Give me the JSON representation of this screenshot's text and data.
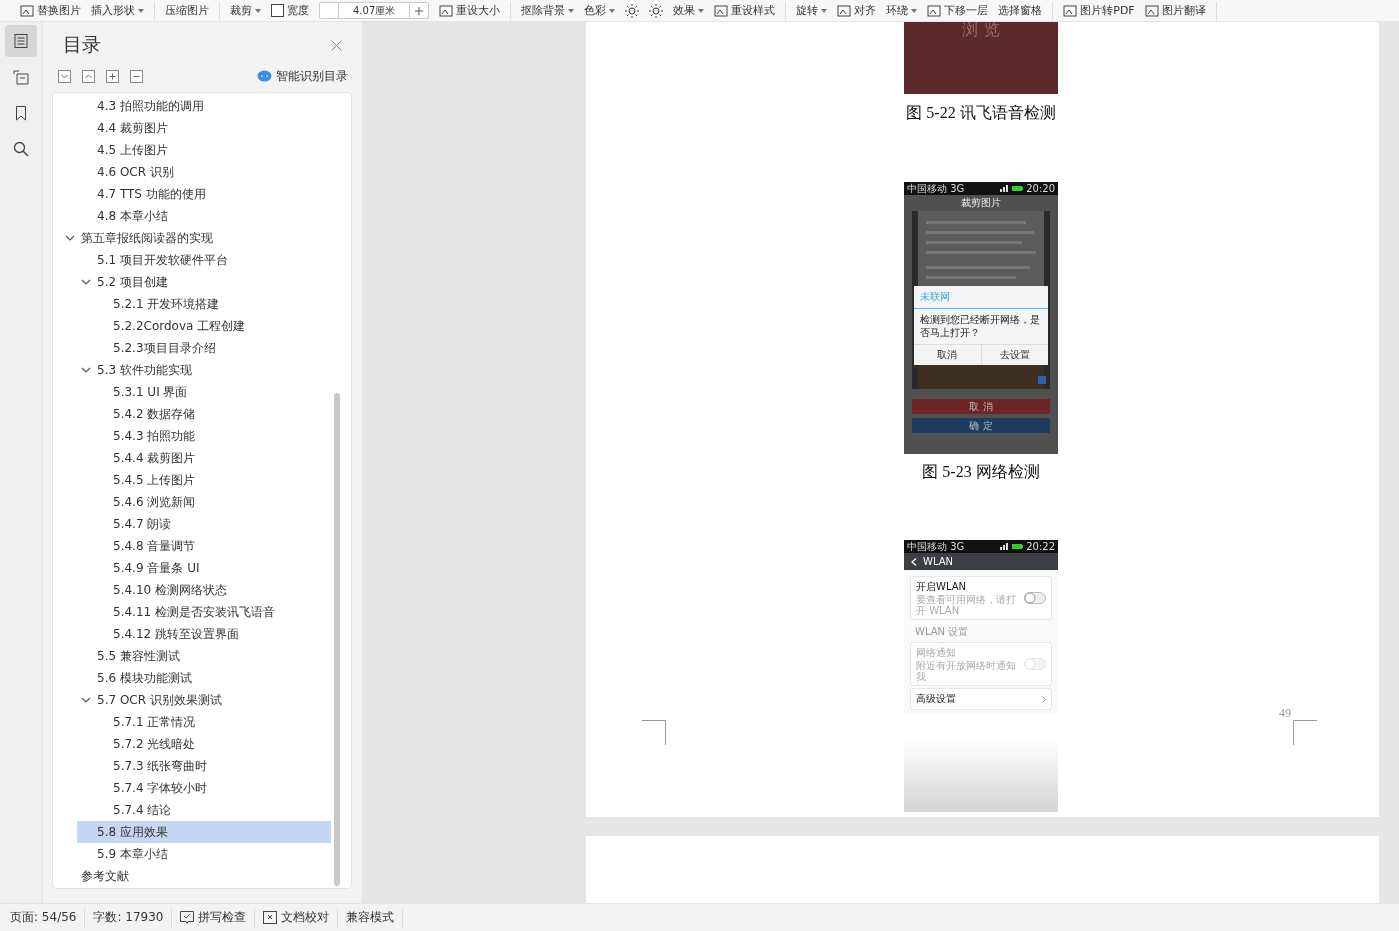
{
  "toolbar": [
    [
      {
        "label": "替换图片",
        "kind": "icon"
      },
      {
        "label": "插入形状",
        "kind": "dropdown"
      }
    ],
    [
      {
        "label": "压缩图片",
        "kind": "plain"
      }
    ],
    [
      {
        "label": "裁剪",
        "kind": "dropdown"
      },
      {
        "label": "宽度",
        "kind": "check",
        "checked": false
      },
      {
        "label": "4.07厘米",
        "kind": "field"
      },
      {
        "label": "重设大小",
        "kind": "icon"
      }
    ],
    [
      {
        "label": "抠除背景",
        "kind": "dropdown"
      },
      {
        "label": "色彩",
        "kind": "dropdown"
      },
      {
        "kind": "sun"
      },
      {
        "kind": "sun"
      },
      {
        "label": "效果",
        "kind": "dropdown"
      },
      {
        "label": "重设样式",
        "kind": "icon"
      }
    ],
    [
      {
        "label": "旋转",
        "kind": "dropdown"
      },
      {
        "label": "对齐",
        "kind": "icon"
      },
      {
        "label": "环绕",
        "kind": "dropdown"
      },
      {
        "label": "下移一层",
        "kind": "icon"
      },
      {
        "label": "选择窗格",
        "kind": "plain"
      }
    ],
    [
      {
        "label": "图片转PDF",
        "kind": "icon"
      },
      {
        "label": "图片翻译",
        "kind": "icon"
      }
    ]
  ],
  "nav": [
    {
      "kind": "toc",
      "selected": true
    },
    {
      "kind": "outline",
      "selected": false
    },
    {
      "kind": "bookmark",
      "selected": false
    },
    {
      "kind": "search",
      "selected": false
    }
  ],
  "toc": {
    "title": "目录",
    "smart_label": "智能识别目录",
    "continued": [
      {
        "label": "4.3 拍照功能的调用",
        "selected": false
      },
      {
        "label": "4.4 裁剪图片",
        "selected": false
      },
      {
        "label": "4.5  上传图片",
        "selected": false
      },
      {
        "label": "4.6 OCR 识别",
        "selected": false
      },
      {
        "label": "4.7 TTS 功能的使用",
        "selected": false
      },
      {
        "label": "4.8  本章小结",
        "selected": false
      }
    ],
    "items": [
      {
        "label": "第五章报纸阅读器的实现",
        "selected": false,
        "expanded": true,
        "children": [
          {
            "label": "5.1 项目开发软硬件平台",
            "selected": false
          },
          {
            "label": "5.2 项目创建",
            "selected": false,
            "expanded": true,
            "children": [
              {
                "label": "5.2.1  开发环境搭建",
                "selected": false
              },
              {
                "label": "5.2.2Cordova 工程创建",
                "selected": false
              },
              {
                "label": "5.2.3项目目录介绍",
                "selected": false
              }
            ]
          },
          {
            "label": "5.3 软件功能实现",
            "selected": false,
            "expanded": true,
            "children": [
              {
                "label": "5.3.1 UI 界面",
                "selected": false
              },
              {
                "label": "5.4.2 数据存储",
                "selected": false
              },
              {
                "label": "5.4.3  拍照功能",
                "selected": false
              },
              {
                "label": "5.4.4  裁剪图片",
                "selected": false
              },
              {
                "label": "5.4.5  上传图片",
                "selected": false
              },
              {
                "label": "5.4.6  浏览新闻",
                "selected": false
              },
              {
                "label": "5.4.7  朗读",
                "selected": false
              },
              {
                "label": "5.4.8  音量调节",
                "selected": false
              },
              {
                "label": "5.4.9  音量条 UI",
                "selected": false
              },
              {
                "label": "5.4.10 检测网络状态",
                "selected": false
              },
              {
                "label": "5.4.11 检测是否安装讯飞语音",
                "selected": false
              },
              {
                "label": "5.4.12 跳转至设置界面",
                "selected": false
              }
            ]
          },
          {
            "label": "5.5  兼容性测试",
            "selected": false
          },
          {
            "label": "5.6  模块功能测试",
            "selected": false
          },
          {
            "label": "5.7  OCR 识别效果测试",
            "selected": false,
            "expanded": true,
            "children": [
              {
                "label": "5.7.1 正常情况",
                "selected": false
              },
              {
                "label": "5.7.2 光线暗处",
                "selected": false
              },
              {
                "label": "5.7.3 纸张弯曲时",
                "selected": false
              },
              {
                "label": "5.7.4 字体较小时",
                "selected": false
              },
              {
                "label": "5.7.4 结论",
                "selected": false
              }
            ]
          },
          {
            "label": "5.8  应用效果",
            "selected": true
          },
          {
            "label": "5.9  本章小结",
            "selected": false
          }
        ]
      },
      {
        "label": "参考文献",
        "selected": false
      }
    ]
  },
  "document": {
    "top_image_label": "浏 览",
    "caption_1": "图 5-22  讯飞语音检测",
    "phone_1": {
      "carrier": "中国移动 3G",
      "time": "20:20",
      "title": "裁剪图片",
      "dialog": {
        "title": "未联网",
        "message": "检测到您已经断开网络，是否马上打开？",
        "buttons": [
          "取消",
          "去设置"
        ]
      },
      "buttons": [
        "取 消",
        "确 定"
      ]
    },
    "caption_2": "图 5-23  网络检测",
    "phone_2": {
      "carrier": "中国移动 3G",
      "time": "20:22",
      "title": "WLAN",
      "rows": [
        {
          "kind": "toggle",
          "title": "开启WLAN",
          "subtitle": "要查看可用网络，请打开 WLAN",
          "on": false,
          "disabled": false
        },
        {
          "kind": "section",
          "title": "WLAN 设置"
        },
        {
          "kind": "toggle",
          "title": "网络通知",
          "subtitle": "附近有开放网络时通知我",
          "on": false,
          "disabled": true
        },
        {
          "kind": "link",
          "title": "高级设置"
        }
      ]
    },
    "page_number": "49"
  },
  "status_bar": [
    {
      "label": "页面: 54/56",
      "kind": "text"
    },
    {
      "label": "字数: 17930",
      "kind": "text"
    },
    {
      "label": "拼写检查",
      "kind": "spell"
    },
    {
      "label": "文档校对",
      "kind": "proof"
    },
    {
      "label": "兼容模式",
      "kind": "text"
    }
  ]
}
